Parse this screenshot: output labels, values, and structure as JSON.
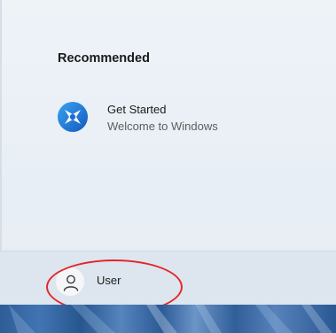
{
  "recommended": {
    "title": "Recommended",
    "items": [
      {
        "title": "Get Started",
        "subtitle": "Welcome to Windows",
        "icon": "get-started-icon"
      }
    ]
  },
  "footer": {
    "user": {
      "label": "User",
      "icon": "user-avatar-icon"
    }
  },
  "colors": {
    "menu_background": "#eef3f8",
    "footer_background": "#dde5ee",
    "highlight_ring": "#e2262c",
    "icon_blue": "#1a6fd4"
  }
}
